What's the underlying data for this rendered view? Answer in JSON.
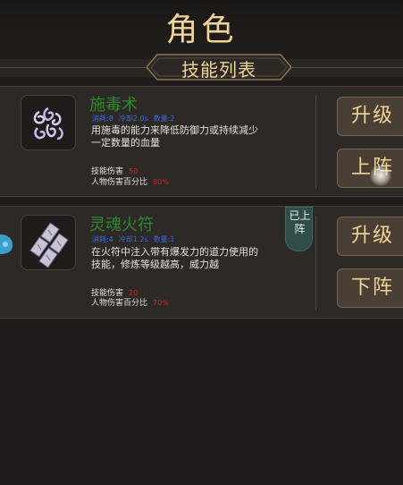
{
  "page": {
    "title": "角色"
  },
  "section": {
    "title": "技能列表"
  },
  "skills": [
    {
      "name": "施毒术",
      "meta": {
        "cost": "消耗:8",
        "cooldown": "冷却2.0s",
        "count": "数量:2"
      },
      "description": "用施毒的能力来降低防御力或持续减少一定数量的血量",
      "stats": [
        {
          "label": "技能伤害",
          "value": "50"
        },
        {
          "label": "人物伤害百分比",
          "value": "80%"
        }
      ],
      "buttons": {
        "upgrade": "升级",
        "deploy": "上阵"
      },
      "icon": "poison-swirl-icon"
    },
    {
      "name": "灵魂火符",
      "meta": {
        "cost": "消耗:4",
        "cooldown": "冷却1.2s",
        "count": "数量:1"
      },
      "description": "在火符中注入带有爆发力的道力使用的技能，修炼等级越高，威力越",
      "stats": [
        {
          "label": "技能伤害",
          "value": "20"
        },
        {
          "label": "人物伤害百分比",
          "value": "70%"
        }
      ],
      "badge": "已上阵",
      "buttons": {
        "upgrade": "升级",
        "deploy": "下阵"
      },
      "icon": "talisman-cards-icon"
    }
  ],
  "colors": {
    "gold": "#f1d497",
    "skill_name": "#2f8a2c",
    "meta": "#3c6ae0",
    "stat_value": "#c92b23",
    "badge": "#2f4d49"
  }
}
